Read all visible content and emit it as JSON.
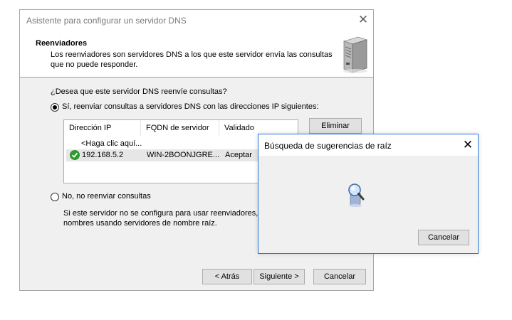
{
  "wizard": {
    "title": "Asistente para configurar un servidor DNS",
    "close_glyph": "✕",
    "header": {
      "title": "Reenviadores",
      "desc_line1": "Los reenviadores son servidores DNS a los que este servidor envía las consultas",
      "desc_line2": "que no puede responder.",
      "icon": "server-icon"
    },
    "question": "¿Desea que este servidor DNS reenvíe consultas?",
    "option_yes": "Sí, reenviar consultas a servidores DNS con las direcciones IP siguientes:",
    "option_yes_selected": true,
    "table": {
      "columns": [
        "Dirección IP",
        "FQDN de servidor",
        "Validado"
      ],
      "new_row_prompt": "<Haga clic aquí...",
      "rows": [
        {
          "status_icon": "check-icon",
          "ip": "192.168.5.2",
          "fqdn": "WIN-2BOONJGRE...",
          "validated": "Aceptar"
        }
      ]
    },
    "remove_button": "Eliminar",
    "option_no": "No, no reenviar consultas",
    "no_desc_line1": "Si este servidor no se configura para usar reenviadores,",
    "no_desc_line2": "nombres usando servidores de nombre raíz.",
    "buttons": {
      "back": "< Atrás",
      "next": "Siguiente >",
      "cancel": "Cancelar"
    }
  },
  "popup": {
    "title": "Búsqueda de sugerencias de raíz",
    "close_glyph": "✕",
    "icon": "search-icon",
    "cancel_button": "Cancelar"
  },
  "colors": {
    "popup_border": "#2b79d7",
    "dialog_bg": "#f0f0f0",
    "check_green": "#2e9e2e"
  }
}
